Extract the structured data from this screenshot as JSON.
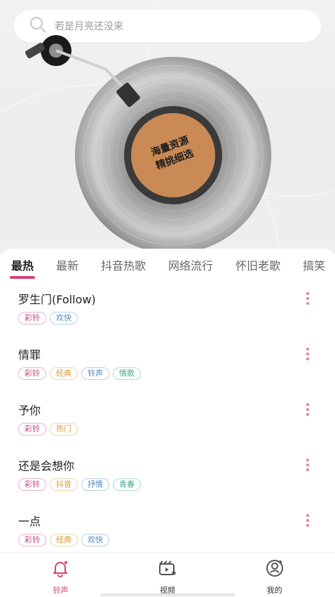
{
  "search": {
    "placeholder": "若是月亮还没来",
    "icon": "search-icon"
  },
  "hero": {
    "label_line1": "海量资源",
    "label_line2": "精挑细选"
  },
  "tabs": [
    {
      "label": "最热",
      "active": true
    },
    {
      "label": "最新"
    },
    {
      "label": "抖音热歌"
    },
    {
      "label": "网络流行"
    },
    {
      "label": "怀旧老歌"
    },
    {
      "label": "搞笑"
    }
  ],
  "songs": [
    {
      "title": "罗生门(Follow)",
      "tags": [
        "彩铃",
        "欢快"
      ]
    },
    {
      "title": "情罪",
      "tags": [
        "彩铃",
        "经典",
        "铃声",
        "情歌"
      ]
    },
    {
      "title": "予你",
      "tags": [
        "彩铃",
        "热门"
      ]
    },
    {
      "title": "还是会想你",
      "tags": [
        "彩铃",
        "抖音",
        "抒情",
        "青春"
      ]
    },
    {
      "title": "一点",
      "tags": [
        "彩铃",
        "经典",
        "欢快"
      ]
    }
  ],
  "tag_colors": {
    "彩铃": "#c2477e",
    "欢快": "#4f86c6",
    "经典": "#d89a3a",
    "铃声": "#4f86c6",
    "情歌": "#3aa98a",
    "热门": "#d89a3a",
    "抖音": "#d89a3a",
    "抒情": "#4f86c6",
    "青春": "#3aa98a"
  },
  "nav": [
    {
      "label": "铃声",
      "icon": "bell-icon",
      "active": true
    },
    {
      "label": "视频",
      "icon": "video-icon"
    },
    {
      "label": "我的",
      "icon": "user-icon"
    }
  ],
  "accent_color": "#d74276"
}
